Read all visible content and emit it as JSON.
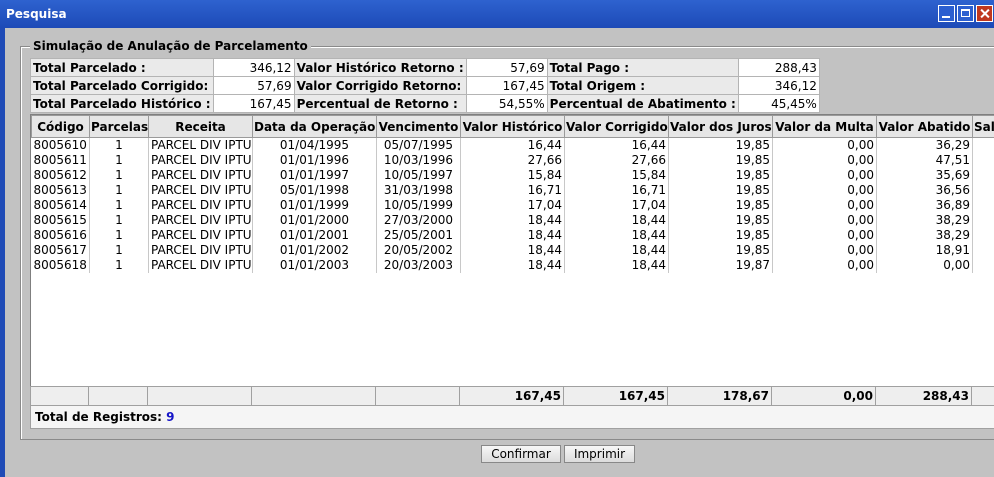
{
  "window": {
    "title": "Pesquisa"
  },
  "fieldset": {
    "legend": "Simulação de Anulação de Parcelamento"
  },
  "summary": [
    [
      {
        "label": "Total Parcelado :",
        "value": "346,12"
      },
      {
        "label": "Valor Histórico Retorno :",
        "value": "57,69"
      },
      {
        "label": "Total Pago :",
        "value": "288,43"
      }
    ],
    [
      {
        "label": "Total Parcelado Corrigido:",
        "value": "57,69"
      },
      {
        "label": "Valor Corrigido Retorno:",
        "value": "167,45"
      },
      {
        "label": "Total Origem :",
        "value": "346,12"
      }
    ],
    [
      {
        "label": "Total Parcelado Histórico :",
        "value": "167,45"
      },
      {
        "label": "Percentual de Retorno :",
        "value": "54,55%"
      },
      {
        "label": "Percentual de Abatimento :",
        "value": "45,45%"
      }
    ]
  ],
  "table": {
    "columns": [
      "Código",
      "Parcelas",
      "Receita",
      "Data da Operação",
      "Vencimento",
      "Valor Histórico",
      "Valor Corrigido",
      "Valor dos Juros",
      "Valor da Multa",
      "Valor Abatido",
      "Sald"
    ],
    "rows": [
      [
        "8005610",
        "1",
        "PARCEL DIV IPTU",
        "01/04/1995",
        "05/07/1995",
        "16,44",
        "16,44",
        "19,85",
        "0,00",
        "36,29",
        ""
      ],
      [
        "8005611",
        "1",
        "PARCEL DIV IPTU",
        "01/01/1996",
        "10/03/1996",
        "27,66",
        "27,66",
        "19,85",
        "0,00",
        "47,51",
        ""
      ],
      [
        "8005612",
        "1",
        "PARCEL DIV IPTU",
        "01/01/1997",
        "10/05/1997",
        "15,84",
        "15,84",
        "19,85",
        "0,00",
        "35,69",
        ""
      ],
      [
        "8005613",
        "1",
        "PARCEL DIV IPTU",
        "05/01/1998",
        "31/03/1998",
        "16,71",
        "16,71",
        "19,85",
        "0,00",
        "36,56",
        ""
      ],
      [
        "8005614",
        "1",
        "PARCEL DIV IPTU",
        "01/01/1999",
        "10/05/1999",
        "17,04",
        "17,04",
        "19,85",
        "0,00",
        "36,89",
        ""
      ],
      [
        "8005615",
        "1",
        "PARCEL DIV IPTU",
        "01/01/2000",
        "27/03/2000",
        "18,44",
        "18,44",
        "19,85",
        "0,00",
        "38,29",
        ""
      ],
      [
        "8005616",
        "1",
        "PARCEL DIV IPTU",
        "01/01/2001",
        "25/05/2001",
        "18,44",
        "18,44",
        "19,85",
        "0,00",
        "38,29",
        ""
      ],
      [
        "8005617",
        "1",
        "PARCEL DIV IPTU",
        "01/01/2002",
        "20/05/2002",
        "18,44",
        "18,44",
        "19,85",
        "0,00",
        "18,91",
        ""
      ],
      [
        "8005618",
        "1",
        "PARCEL DIV IPTU",
        "01/01/2003",
        "20/03/2003",
        "18,44",
        "18,44",
        "19,87",
        "0,00",
        "0,00",
        ""
      ]
    ],
    "totals": [
      "",
      "",
      "",
      "",
      "",
      "167,45",
      "167,45",
      "178,67",
      "0,00",
      "288,43",
      ""
    ]
  },
  "footer": {
    "label": "Total de Registros:",
    "count": "9"
  },
  "buttons": {
    "confirm": "Confirmar",
    "print": "Imprimir"
  }
}
